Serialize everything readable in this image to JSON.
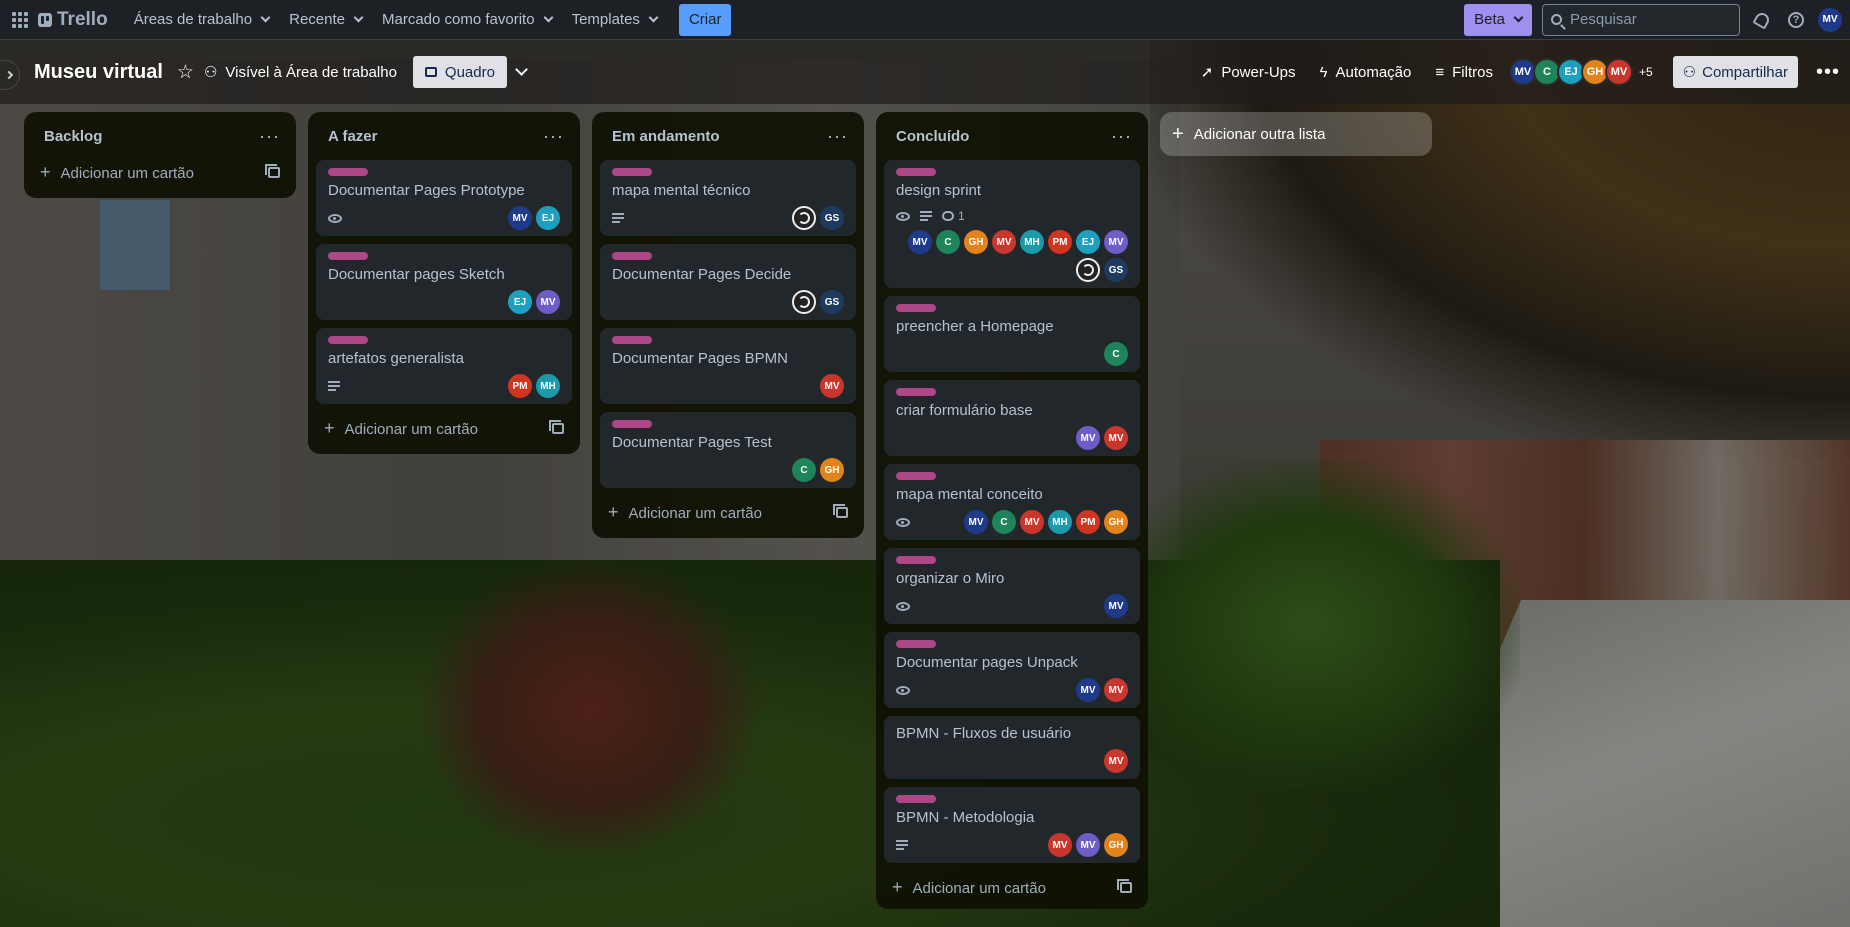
{
  "topbar": {
    "logo": "Trello",
    "menus": [
      "Áreas de trabalho",
      "Recente",
      "Marcado como favorito",
      "Templates"
    ],
    "create_label": "Criar",
    "beta_label": "Beta",
    "search_placeholder": "Pesquisar",
    "user_initials": "MV"
  },
  "board": {
    "title": "Museu virtual",
    "visibility_label": "Visível à Área de trabalho",
    "view_label": "Quadro",
    "powerups_label": "Power-Ups",
    "automation_label": "Automação",
    "filters_label": "Filtros",
    "members": [
      "MV",
      "C",
      "EJ",
      "GH",
      "MV"
    ],
    "members_more": "+5",
    "share_label": "Compartilhar"
  },
  "colors": {
    "MV_dark": "#1f3a8a",
    "MV_purple": "#6e5dc6",
    "MV_red": "#c9372c",
    "C": "#1f845a",
    "EJ": "#1d9fbf",
    "GH": "#e2841b",
    "PM": "#d1341f",
    "MH": "#1b9aaa",
    "GS": "#1e3a5f",
    "label_pink": "#ae4787"
  },
  "lists": [
    {
      "title": "Backlog",
      "add_label": "Adicionar um cartão",
      "cards": []
    },
    {
      "title": "A fazer",
      "add_label": "Adicionar um cartão",
      "cards": [
        {
          "title": "Documentar Pages Prototype"
        },
        {
          "title": "Documentar pages Sketch"
        },
        {
          "title": "artefatos generalista"
        }
      ]
    },
    {
      "title": "Em andamento",
      "add_label": "Adicionar um cartão",
      "cards": [
        {
          "title": "mapa mental técnico"
        },
        {
          "title": "Documentar Pages Decide"
        },
        {
          "title": "Documentar Pages BPMN"
        },
        {
          "title": "Documentar Pages Test"
        }
      ]
    },
    {
      "title": "Concluído",
      "add_label": "Adicionar um cartão",
      "cards": [
        {
          "title": "design sprint",
          "comments": "1"
        },
        {
          "title": "preencher a Homepage"
        },
        {
          "title": "criar formulário base"
        },
        {
          "title": "mapa mental conceito"
        },
        {
          "title": "organizar o Miro"
        },
        {
          "title": "Documentar pages Unpack"
        },
        {
          "title": "BPMN - Fluxos de usuário"
        },
        {
          "title": "BPMN - Metodologia"
        }
      ]
    }
  ],
  "add_list_label": "Adicionar outra lista",
  "avatars": {
    "MV": "MV",
    "C": "C",
    "EJ": "EJ",
    "GH": "GH",
    "PM": "PM",
    "MH": "MH",
    "GS": "GS"
  }
}
